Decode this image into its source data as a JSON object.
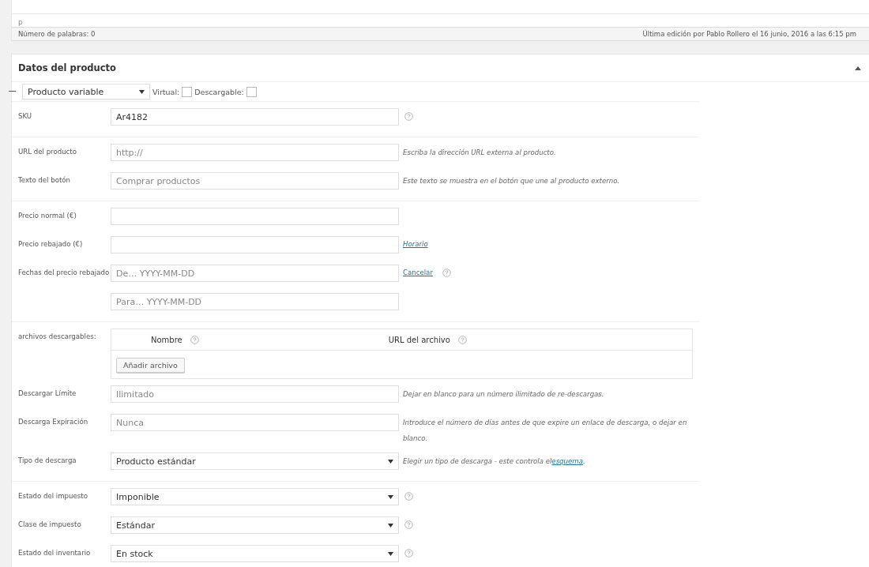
{
  "editor": {
    "path": "p",
    "word_count": "Número de palabras: 0",
    "last_edit": "Última edición por Pablo Rollero el 16 junio, 2016 a las 6:15 pm"
  },
  "panel": {
    "title": "Datos del producto",
    "expanded": true,
    "product_type": "Producto variable",
    "options": [
      {
        "label": "Virtual:",
        "checked": false
      },
      {
        "label": "Descargable:",
        "checked": false
      }
    ],
    "groups": [
      {
        "divider": true,
        "fields": [
          {
            "kind": "text",
            "label": "SKU",
            "value": "Ar4182",
            "help": true
          }
        ]
      },
      {
        "divider": true,
        "fields": [
          {
            "kind": "text",
            "label": "URL del producto",
            "placeholder": "http://",
            "description": "Escriba la dirección URL externa al producto."
          },
          {
            "kind": "text",
            "label": "Texto del botón",
            "placeholder": "Comprar productos",
            "description": "Este texto se muestra en el botón que une al producto externo."
          }
        ]
      },
      {
        "divider": true,
        "fields": [
          {
            "kind": "text",
            "label": "Precio normal (€)"
          },
          {
            "kind": "text",
            "label": "Precio rebajado (€)",
            "link": "Horario"
          },
          {
            "kind": "text",
            "label": "Fechas del precio rebajado",
            "placeholder": "De… YYYY-MM-DD",
            "link": "Cancelar",
            "help": true
          },
          {
            "kind": "text",
            "placeholder": "Para…  YYYY-MM-DD"
          }
        ]
      },
      {
        "divider": true,
        "fields": [
          {
            "kind": "files",
            "label": "archivos descargables:",
            "columns": [
              {
                "label": "Nombre",
                "help": true
              },
              {
                "label": "URL del archivo",
                "help": true
              }
            ],
            "button": "Añadir archivo"
          },
          {
            "kind": "text",
            "label": "Descargar Límite",
            "placeholder": "Ilimitado",
            "description": "Dejar en blanco para un número ilimitado de re-descargas."
          },
          {
            "kind": "text",
            "label": "Descarga Expiración",
            "placeholder": "Nunca",
            "description": "Introduce el número de días antes de que expire un enlace de descarga, o dejar en blanco."
          },
          {
            "kind": "select",
            "label": "Tipo de descarga",
            "value": "Producto estándar",
            "description": "Elegir un tipo de descarga - este controla el",
            "link": "esquema",
            "description_end": "."
          }
        ]
      },
      {
        "divider": true,
        "fields": [
          {
            "kind": "select",
            "label": "Estado del impuesto",
            "value": "Imponible",
            "help": true
          },
          {
            "kind": "select",
            "label": "Clase de impuesto",
            "value": "Estándar",
            "help": true
          },
          {
            "kind": "select",
            "label": "Estado del inventario",
            "value": "En stock",
            "help": true
          }
        ]
      }
    ]
  }
}
